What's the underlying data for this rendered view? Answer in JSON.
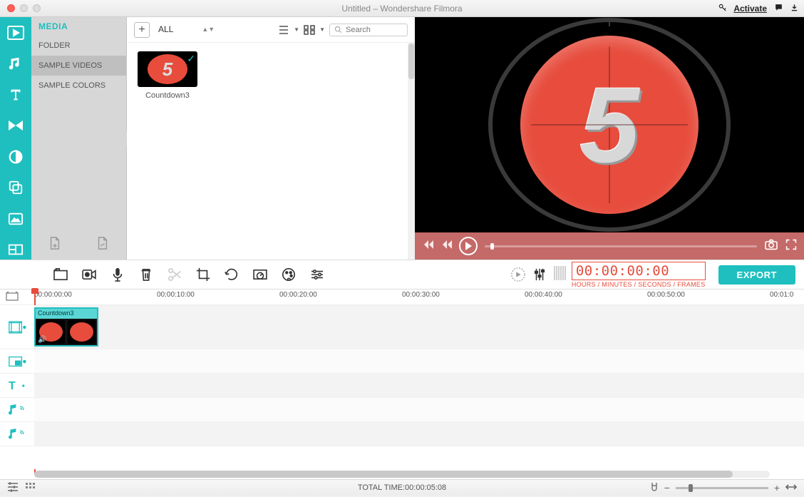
{
  "titlebar": {
    "title": "Untitled – Wondershare Filmora",
    "activate": "Activate"
  },
  "leftrail": [
    {
      "name": "media-icon"
    },
    {
      "name": "music-icon"
    },
    {
      "name": "text-icon"
    },
    {
      "name": "transition-icon"
    },
    {
      "name": "filters-icon"
    },
    {
      "name": "overlay-icon"
    },
    {
      "name": "elements-icon"
    },
    {
      "name": "splitscreen-icon"
    }
  ],
  "mediapanel": {
    "header": "MEDIA",
    "items": [
      "FOLDER",
      "SAMPLE VIDEOS",
      "SAMPLE COLORS"
    ],
    "selected_index": 1
  },
  "browser": {
    "filter": "ALL",
    "search_placeholder": "Search",
    "thumbs": [
      {
        "label": "Countdown3",
        "selected": true
      }
    ]
  },
  "timecode": {
    "value": "00:00:00:00",
    "label": "HOURS / MINUTES / SECONDS / FRAMES"
  },
  "export_label": "EXPORT",
  "ruler_ticks": [
    "00:00:00:00",
    "00:00:10:00",
    "00:00:20:00",
    "00:00:30:00",
    "00:00:40:00",
    "00:00:50:00",
    "00:01:0"
  ],
  "clip": {
    "title": "Countdown3"
  },
  "status": {
    "total_label": "TOTAL TIME:",
    "total_value": "00:00:05:08"
  }
}
